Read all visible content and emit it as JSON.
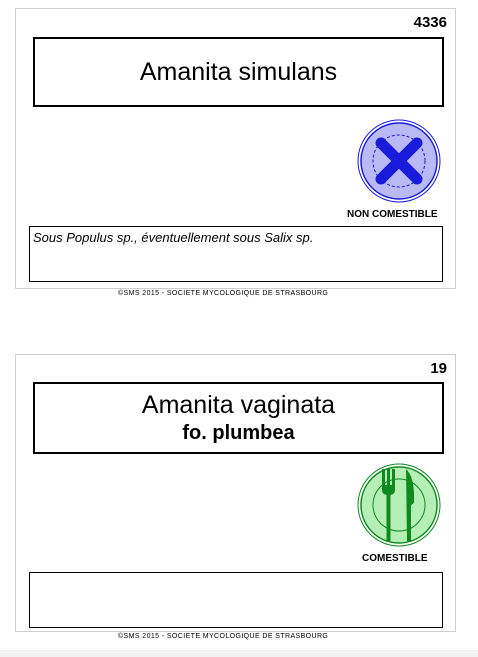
{
  "cards": [
    {
      "number": "4336",
      "name": "Amanita simulans",
      "subname": "",
      "status": "NON COMESTIBLE",
      "status_icon": "not-edible-cross-icon",
      "habitat": "Sous Populus sp., éventuellement sous Salix sp.",
      "copyright": "©SMS 2015 - SOCIETE MYCOLOGIQUE DE STRASBOURG",
      "colors": {
        "icon_fill": "#b9b9f5",
        "icon_mark": "#1a1adb"
      }
    },
    {
      "number": "19",
      "name": "Amanita vaginata",
      "subname": "fo. plumbea",
      "status": "COMESTIBLE",
      "status_icon": "edible-cutlery-icon",
      "habitat": "",
      "copyright": "©SMS 2015 - SOCIETE MYCOLOGIQUE DE STRASBOURG",
      "colors": {
        "icon_fill": "#b6efb6",
        "icon_mark": "#0f8a1f"
      }
    }
  ]
}
